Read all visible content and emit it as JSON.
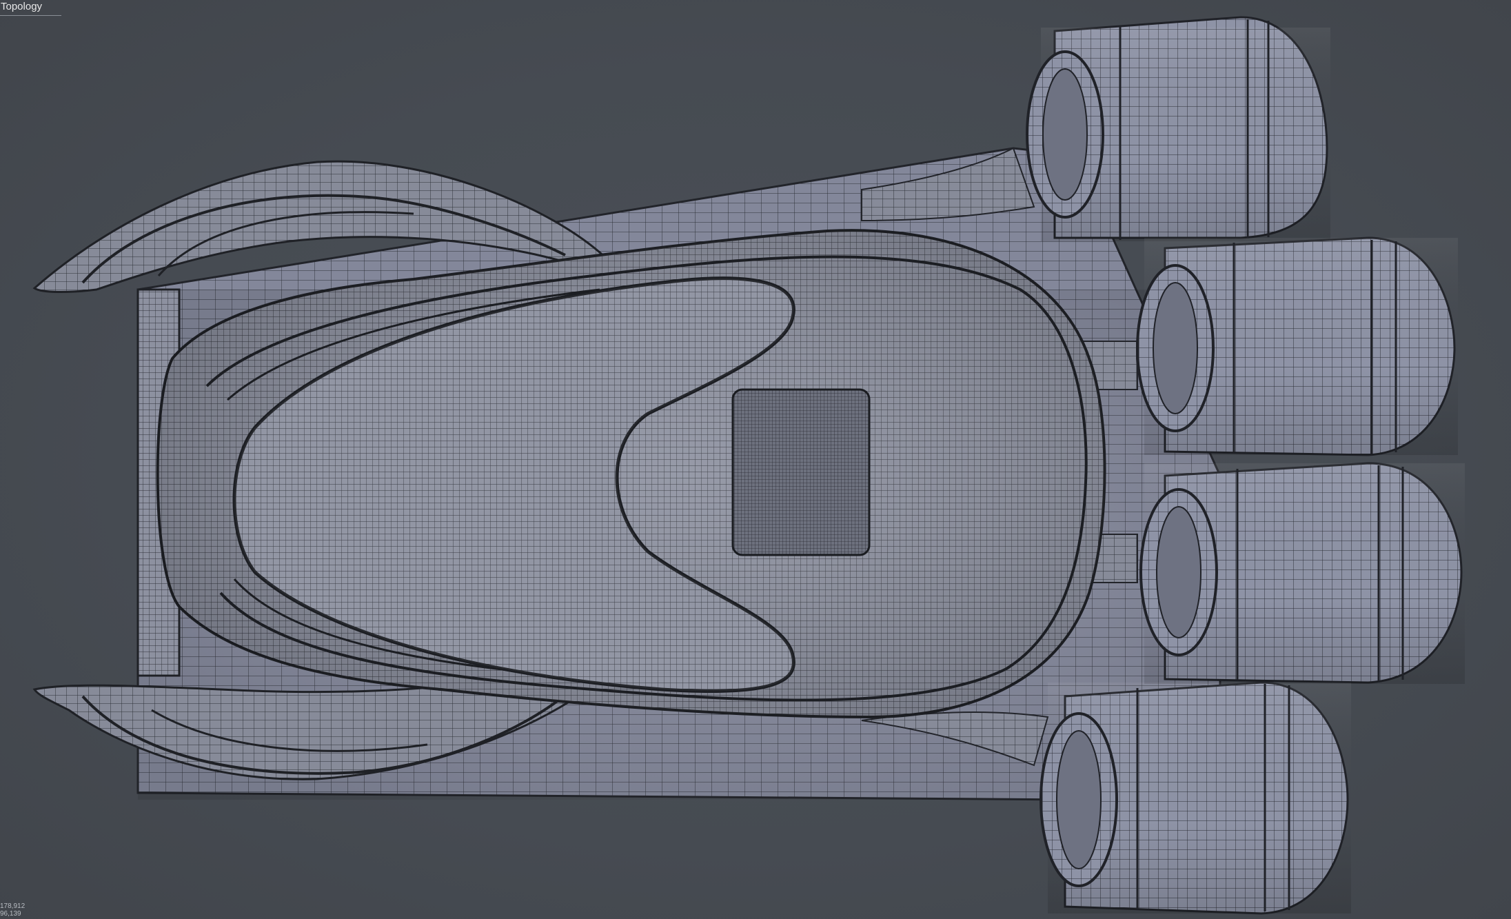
{
  "viewport": {
    "label": "Topology",
    "background": "#454a51",
    "mesh_fill": "#8b8f9f",
    "wire_color": "#2a2c33"
  },
  "stats": {
    "line1": "178,912",
    "line2": "96,139"
  }
}
